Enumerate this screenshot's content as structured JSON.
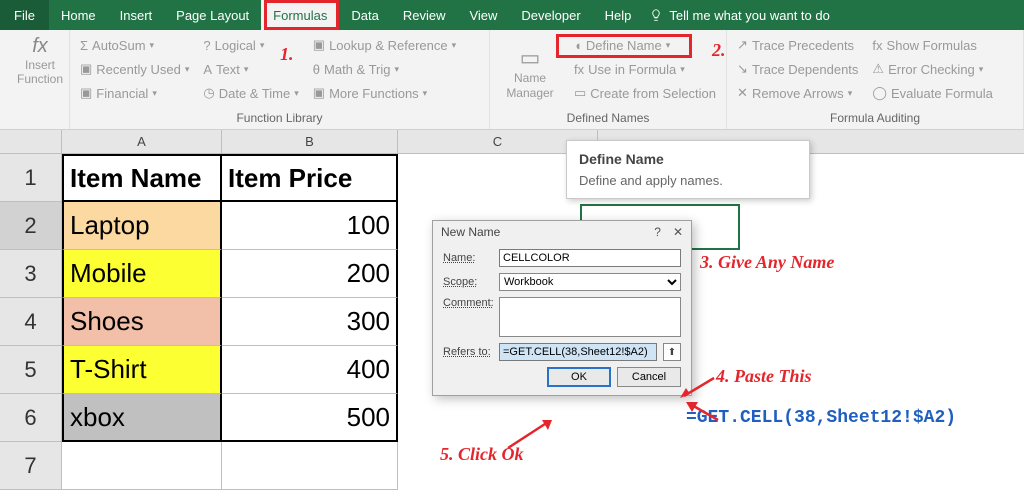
{
  "menubar": {
    "file": "File",
    "tabs": [
      "Home",
      "Insert",
      "Page Layout",
      "Formulas",
      "Data",
      "Review",
      "View",
      "Developer",
      "Help"
    ],
    "active_index": 3,
    "tell_me": "Tell me what you want to do"
  },
  "ribbon": {
    "insert_function": "Insert Function",
    "function_library": {
      "label": "Function Library",
      "col1": [
        "AutoSum",
        "Recently Used",
        "Financial"
      ],
      "col2": [
        "Logical",
        "Text",
        "Date & Time"
      ],
      "col3": [
        "Lookup & Reference",
        "Math & Trig",
        "More Functions"
      ]
    },
    "defined_names": {
      "label": "Defined Names",
      "name_manager": "Name Manager",
      "items": [
        "Define Name",
        "Use in Formula",
        "Create from Selection"
      ]
    },
    "formula_auditing": {
      "label": "Formula Auditing",
      "col1": [
        "Trace Precedents",
        "Trace Dependents",
        "Remove Arrows"
      ],
      "col2": [
        "Show Formulas",
        "Error Checking",
        "Evaluate Formula"
      ]
    }
  },
  "tooltip": {
    "title": "Define Name",
    "body": "Define and apply names."
  },
  "dialog": {
    "title": "New Name",
    "name_label": "Name:",
    "name_value": "CELLCOLOR",
    "scope_label": "Scope:",
    "scope_value": "Workbook",
    "comment_label": "Comment:",
    "comment_value": "",
    "refers_label": "Refers to:",
    "refers_value": "=GET.CELL(38,Sheet12!$A2)",
    "ok": "OK",
    "cancel": "Cancel"
  },
  "sheet": {
    "columns": [
      "A",
      "B",
      "C"
    ],
    "row_numbers": [
      "1",
      "2",
      "3",
      "4",
      "5",
      "6",
      "7"
    ],
    "selected_row": 2,
    "headers": {
      "a": "Item Name",
      "b": "Item Price"
    },
    "rows": [
      {
        "a": "Laptop",
        "b": "100",
        "color": "#fcd9a0"
      },
      {
        "a": "Mobile",
        "b": "200",
        "color": "#fcff32"
      },
      {
        "a": "Shoes",
        "b": "300",
        "color": "#f2c0a8"
      },
      {
        "a": "T-Shirt",
        "b": "400",
        "color": "#fcff32"
      },
      {
        "a": "xbox",
        "b": "500",
        "color": "#c0c0c0"
      }
    ]
  },
  "annotations": {
    "n1": "1.",
    "n2": "2.",
    "n3": "3. Give Any Name",
    "n4": "4. Paste This",
    "n5": "5. Click Ok",
    "formula": "=GET.CELL(38,Sheet12!$A2)"
  },
  "chart_data": {
    "type": "table",
    "title": "Item Name vs Item Price",
    "columns": [
      "Item Name",
      "Item Price"
    ],
    "rows": [
      [
        "Laptop",
        100
      ],
      [
        "Mobile",
        200
      ],
      [
        "Shoes",
        300
      ],
      [
        "T-Shirt",
        400
      ],
      [
        "xbox",
        500
      ]
    ]
  }
}
